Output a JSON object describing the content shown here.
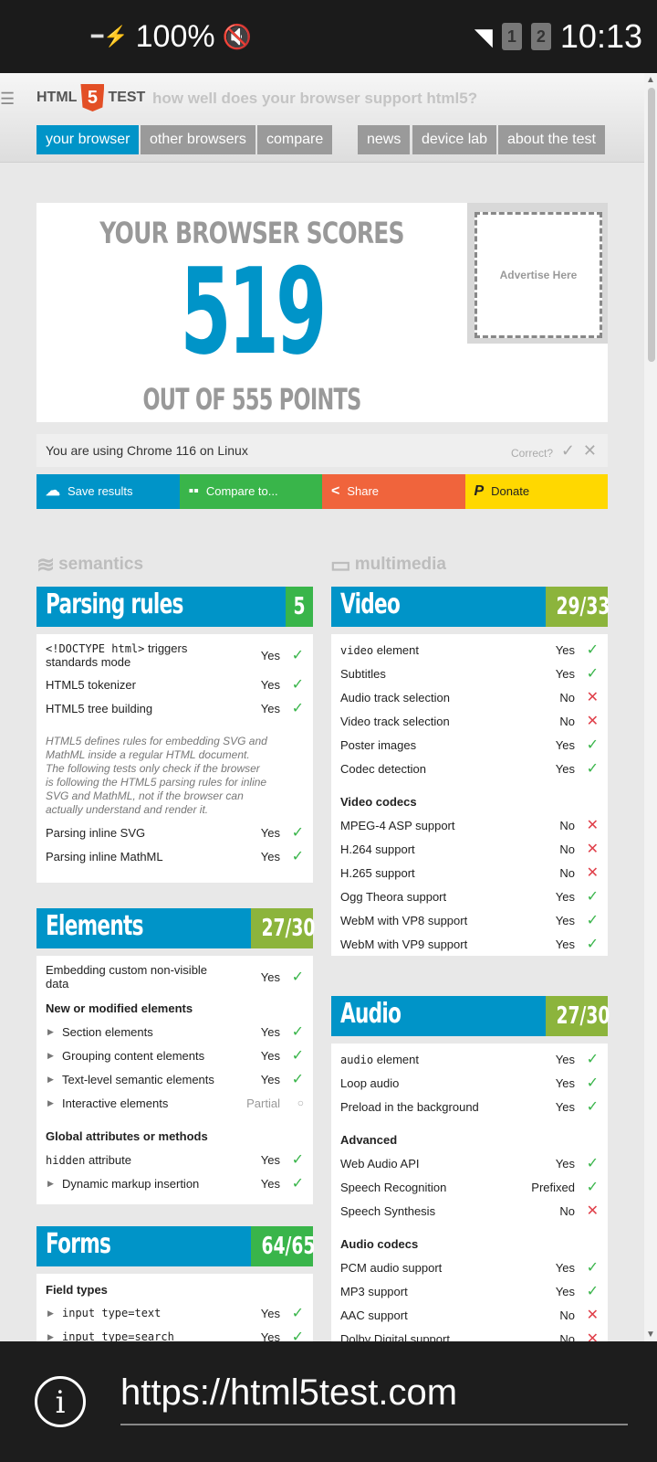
{
  "status_bar": {
    "battery": "100%",
    "time": "10:13",
    "sim1": "1",
    "sim2": "2"
  },
  "header": {
    "logo_left": "HTML",
    "logo_badge": "5",
    "logo_right": "TEST",
    "tagline": "how well does your browser support html5?",
    "nav": [
      "your browser",
      "other browsers",
      "compare",
      "news",
      "device lab",
      "about the test"
    ]
  },
  "score": {
    "top": "YOUR BROWSER SCORES",
    "value": "519",
    "bottom": "OUT OF 555 POINTS",
    "advert": "Advertise Here"
  },
  "using": {
    "text": "You are using Chrome 116 on Linux",
    "correct": "Correct?"
  },
  "actions": {
    "save": "Save results",
    "compare": "Compare to...",
    "share": "Share",
    "donate": "Donate"
  },
  "categories": {
    "semantics": "semantics",
    "multimedia": "multimedia"
  },
  "parsing": {
    "title": "Parsing rules",
    "score": "5",
    "rows": [
      {
        "code": "<!DOCTYPE html>",
        "label": " triggers",
        "label2": "standards mode",
        "val": "Yes"
      },
      {
        "label": "HTML5 tokenizer",
        "val": "Yes"
      },
      {
        "label": "HTML5 tree building",
        "val": "Yes"
      }
    ],
    "note": "HTML5 defines rules for embedding SVG and MathML inside a regular HTML document. The following tests only check if the browser is following the HTML5 parsing rules for inline SVG and MathML, not if the browser can actually understand and render it.",
    "rows2": [
      {
        "label": "Parsing inline SVG",
        "val": "Yes"
      },
      {
        "label": "Parsing inline MathML",
        "val": "Yes"
      }
    ]
  },
  "elements": {
    "title": "Elements",
    "score": "27/30",
    "row0": {
      "label": "Embedding custom non-visible",
      "label2": "data",
      "val": "Yes"
    },
    "sub1": "New or modified elements",
    "rows1": [
      {
        "label": "Section elements",
        "val": "Yes"
      },
      {
        "label": "Grouping content elements",
        "val": "Yes"
      },
      {
        "label": "Text-level semantic elements",
        "val": "Yes"
      },
      {
        "label": "Interactive elements",
        "val": "Partial"
      }
    ],
    "sub2": "Global attributes or methods",
    "rows2": [
      {
        "code": "hidden",
        "label": " attribute",
        "val": "Yes"
      },
      {
        "label": "Dynamic markup insertion",
        "val": "Yes"
      }
    ]
  },
  "forms": {
    "title": "Forms",
    "score": "64/65",
    "sub1": "Field types",
    "rows": [
      {
        "code": "input type=text",
        "val": "Yes"
      },
      {
        "code": "input type=search",
        "val": "Yes"
      }
    ]
  },
  "video": {
    "title": "Video",
    "score": "29/33",
    "rows": [
      {
        "code": "video",
        "label": " element",
        "val": "Yes"
      },
      {
        "label": "Subtitles",
        "val": "Yes"
      },
      {
        "label": "Audio track selection",
        "val": "No"
      },
      {
        "label": "Video track selection",
        "val": "No"
      },
      {
        "label": "Poster images",
        "val": "Yes"
      },
      {
        "label": "Codec detection",
        "val": "Yes"
      }
    ],
    "sub1": "Video codecs",
    "rows2": [
      {
        "label": "MPEG-4 ASP support",
        "val": "No"
      },
      {
        "label": "H.264 support",
        "val": "No"
      },
      {
        "label": "H.265 support",
        "val": "No"
      },
      {
        "label": "Ogg Theora support",
        "val": "Yes"
      },
      {
        "label": "WebM with VP8 support",
        "val": "Yes"
      },
      {
        "label": "WebM with VP9 support",
        "val": "Yes"
      }
    ]
  },
  "audio": {
    "title": "Audio",
    "score": "27/30",
    "rows": [
      {
        "code": "audio",
        "label": " element",
        "val": "Yes"
      },
      {
        "label": "Loop audio",
        "val": "Yes"
      },
      {
        "label": "Preload in the background",
        "val": "Yes"
      }
    ],
    "sub1": "Advanced",
    "rows2": [
      {
        "label": "Web Audio API",
        "val": "Yes"
      },
      {
        "label": "Speech Recognition",
        "val": "Prefixed"
      },
      {
        "label": "Speech Synthesis",
        "val": "No"
      }
    ],
    "sub2": "Audio codecs",
    "rows3": [
      {
        "label": "PCM audio support",
        "val": "Yes"
      },
      {
        "label": "MP3 support",
        "val": "Yes"
      },
      {
        "label": "AAC support",
        "val": "No"
      },
      {
        "label": "Dolby Digital support",
        "val": "No"
      }
    ]
  },
  "url_bar": {
    "url": "https://html5test.com"
  }
}
